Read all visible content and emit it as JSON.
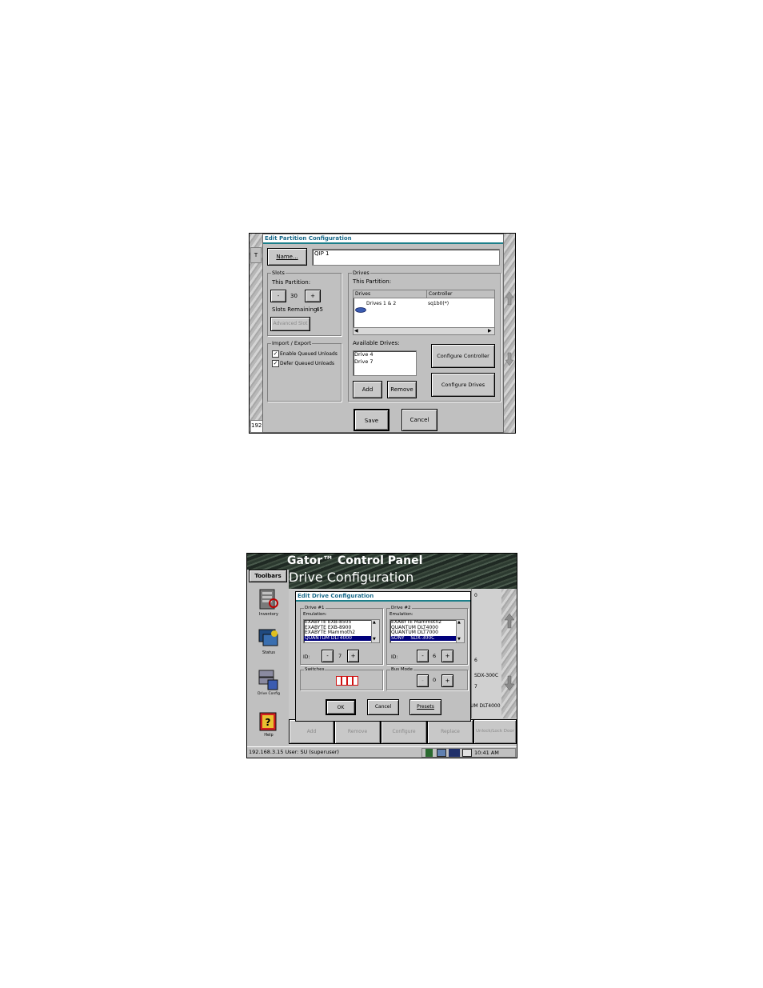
{
  "partition_dialog": {
    "title": "Edit Partition Configuration",
    "name_button": "Name...",
    "name_value": "QIP 1",
    "slots": {
      "caption": "Slots",
      "this_partition_label": "This Partition:",
      "minus": "-",
      "value": "30",
      "plus": "+",
      "remaining_label": "Slots Remaining:",
      "remaining_value": "45",
      "advanced_button": "Advanced Slot"
    },
    "import_export": {
      "caption": "Import / Export",
      "enable_queued_unloads": {
        "label": "Enable Queued Unloads",
        "checked": true
      },
      "defer_queued_unloads": {
        "label": "Defer Queued Unloads",
        "checked": true
      }
    },
    "drives": {
      "caption": "Drives",
      "this_partition_label": "This Partition:",
      "columns": [
        "Drives",
        "Controller"
      ],
      "rows": [
        {
          "drive": "Drives 1 & 2",
          "controller": "sq1b0(*)"
        }
      ],
      "available_label": "Available Drives:",
      "available": [
        "Drive 4",
        "Drive 7"
      ],
      "add_button": "Add",
      "remove_button": "Remove",
      "configure_controller_button": "Configure Controller",
      "configure_drives_button": "Configure Drives"
    },
    "save_button": "Save",
    "cancel_button": "Cancel",
    "left_edge_char": "T",
    "bottom_left_fragment": "192"
  },
  "gator": {
    "app_title": "Gator™ Control Panel",
    "page_title": "Drive Configuration",
    "toolbars_label": "Toolbars",
    "toolbar_items": [
      "Inventory",
      "Status",
      "Drive Config",
      "Help"
    ],
    "dialog": {
      "title": "Edit Drive Configuration",
      "drive1": {
        "caption": "Drive #1",
        "emulation_label": "Emulation:",
        "options": [
          "EXABYTE EXB-8505",
          "EXABYTE EXB-8900",
          "EXABYTE Mammoth2",
          "QUANTUM DLT4000"
        ],
        "selected_index": 3,
        "id_label": "ID:",
        "id_minus": "-",
        "id_value": "7",
        "id_plus": "+"
      },
      "drive2": {
        "caption": "Drive #2",
        "emulation_label": "Emulation:",
        "options": [
          "EXABYTE Mammoth2",
          "QUANTUM DLT4000",
          "QUANTUM DLT7000",
          "SONY    SDX-300C"
        ],
        "selected_index": 3,
        "id_label": "ID:",
        "id_minus": "-",
        "id_value": "6",
        "id_plus": "+"
      },
      "switches_caption": "Switches",
      "switch_count": 4,
      "bus_mode": {
        "caption": "Bus Mode",
        "minus": "-",
        "value": "0",
        "plus": "+"
      },
      "ok_button": "OK",
      "cancel_button": "Cancel",
      "presets_button": "Presets"
    },
    "right_panel": [
      "0",
      "6",
      "SDX-300C",
      "7",
      "UM DLT4000"
    ],
    "bottom_buttons": [
      "Add",
      "Remove",
      "Configure",
      "Replace",
      "Unlock/Lock Door"
    ],
    "status_text": "192.168.3.15 User: SU (superuser)",
    "clock": "10:41 AM",
    "colors": {
      "switch_red": "#d01010",
      "selection": "#00007b",
      "title_teal": "#1c7f8a"
    }
  }
}
